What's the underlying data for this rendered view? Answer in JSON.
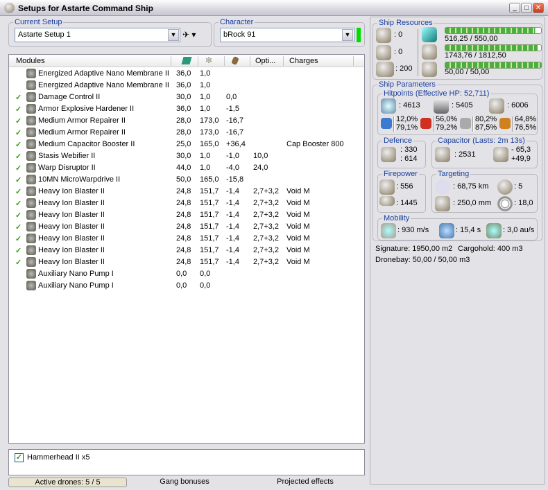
{
  "window": {
    "title": "Setups for Astarte Command Ship",
    "min": "_",
    "max": "□",
    "close": "✕"
  },
  "current_setup": {
    "label": "Current Setup",
    "value": "Astarte Setup 1"
  },
  "character": {
    "label": "Character",
    "value": "bRock 91",
    "status_color": "#00dd00"
  },
  "modules": {
    "headers": [
      "Modules",
      "Opti...",
      "Charges"
    ],
    "header_icons": [
      "cpu-icon",
      "powergrid-icon",
      "capacitor-icon"
    ],
    "rows": [
      {
        "checked": false,
        "name": "Energized Adaptive Nano Membrane II",
        "cpu": "36,0",
        "pg": "1,0",
        "cap": "",
        "opti": "",
        "charges": ""
      },
      {
        "checked": false,
        "name": "Energized Adaptive Nano Membrane II",
        "cpu": "36,0",
        "pg": "1,0",
        "cap": "",
        "opti": "",
        "charges": ""
      },
      {
        "checked": true,
        "name": "Damage Control II",
        "cpu": "30,0",
        "pg": "1,0",
        "cap": "0,0",
        "opti": "",
        "charges": ""
      },
      {
        "checked": true,
        "name": "Armor Explosive Hardener II",
        "cpu": "36,0",
        "pg": "1,0",
        "cap": "-1,5",
        "opti": "",
        "charges": ""
      },
      {
        "checked": true,
        "name": "Medium Armor Repairer II",
        "cpu": "28,0",
        "pg": "173,0",
        "cap": "-16,7",
        "opti": "",
        "charges": ""
      },
      {
        "checked": true,
        "name": "Medium Armor Repairer II",
        "cpu": "28,0",
        "pg": "173,0",
        "cap": "-16,7",
        "opti": "",
        "charges": ""
      },
      {
        "checked": true,
        "name": "Medium Capacitor Booster II",
        "cpu": "25,0",
        "pg": "165,0",
        "cap": "+36,4",
        "opti": "",
        "charges": "Cap Booster 800"
      },
      {
        "checked": true,
        "name": "Stasis Webifier II",
        "cpu": "30,0",
        "pg": "1,0",
        "cap": "-1,0",
        "opti": "10,0",
        "charges": ""
      },
      {
        "checked": true,
        "name": "Warp Disruptor II",
        "cpu": "44,0",
        "pg": "1,0",
        "cap": "-4,0",
        "opti": "24,0",
        "charges": ""
      },
      {
        "checked": true,
        "name": "10MN MicroWarpdrive II",
        "cpu": "50,0",
        "pg": "165,0",
        "cap": "-15,8",
        "opti": "",
        "charges": ""
      },
      {
        "checked": true,
        "name": "Heavy Ion Blaster II",
        "cpu": "24,8",
        "pg": "151,7",
        "cap": "-1,4",
        "opti": "2,7+3,2",
        "charges": "Void M"
      },
      {
        "checked": true,
        "name": "Heavy Ion Blaster II",
        "cpu": "24,8",
        "pg": "151,7",
        "cap": "-1,4",
        "opti": "2,7+3,2",
        "charges": "Void M"
      },
      {
        "checked": true,
        "name": "Heavy Ion Blaster II",
        "cpu": "24,8",
        "pg": "151,7",
        "cap": "-1,4",
        "opti": "2,7+3,2",
        "charges": "Void M"
      },
      {
        "checked": true,
        "name": "Heavy Ion Blaster II",
        "cpu": "24,8",
        "pg": "151,7",
        "cap": "-1,4",
        "opti": "2,7+3,2",
        "charges": "Void M"
      },
      {
        "checked": true,
        "name": "Heavy Ion Blaster II",
        "cpu": "24,8",
        "pg": "151,7",
        "cap": "-1,4",
        "opti": "2,7+3,2",
        "charges": "Void M"
      },
      {
        "checked": true,
        "name": "Heavy Ion Blaster II",
        "cpu": "24,8",
        "pg": "151,7",
        "cap": "-1,4",
        "opti": "2,7+3,2",
        "charges": "Void M"
      },
      {
        "checked": true,
        "name": "Heavy Ion Blaster II",
        "cpu": "24,8",
        "pg": "151,7",
        "cap": "-1,4",
        "opti": "2,7+3,2",
        "charges": "Void M"
      },
      {
        "checked": false,
        "name": "Auxiliary Nano Pump I",
        "cpu": "0,0",
        "pg": "0,0",
        "cap": "",
        "opti": "",
        "charges": ""
      },
      {
        "checked": false,
        "name": "Auxiliary Nano Pump I",
        "cpu": "0,0",
        "pg": "0,0",
        "cap": "",
        "opti": "",
        "charges": ""
      }
    ]
  },
  "drones": {
    "items": [
      {
        "checked": true,
        "name": "Hammerhead II x5"
      }
    ]
  },
  "tabs": [
    "Active drones: 5 / 5",
    "Gang bonuses",
    "Projected effects"
  ],
  "resources": {
    "label": "Ship Resources",
    "turrets": ": 0",
    "launchers": ": 0",
    "calibration": ": 200",
    "cpu": "516,25 / 550,00",
    "cpu_fraction": 0.939,
    "powergrid": "1743,76 / 1812,50",
    "powergrid_fraction": 0.962,
    "drone_bandwidth": "50,00 / 50,00",
    "drone_fraction": 1.0
  },
  "params": {
    "label": "Ship Parameters",
    "hitpoints": {
      "label": "Hitpoints (Effective HP: 52,711)",
      "shield": ": 4613",
      "armor": ": 5405",
      "structure": ": 6006",
      "resists": [
        {
          "a": "12,0%",
          "b": "79,1%"
        },
        {
          "a": "56,0%",
          "b": "79,2%"
        },
        {
          "a": "80,2%",
          "b": "87,5%"
        },
        {
          "a": "64,8%",
          "b": "76,5%"
        }
      ]
    },
    "defence": {
      "label": "Defence",
      "a": ": 330",
      "b": ": 614"
    },
    "capacitor": {
      "label": "Capacitor (Lasts: 2m 13s)",
      "amount": ": 2531",
      "use": "- 65,3",
      "recharge": "+49,9"
    },
    "firepower": {
      "label": "Firepower",
      "a": ": 556",
      "b": ": 1445"
    },
    "targeting": {
      "label": "Targeting",
      "range": ": 68,75 km",
      "targets": ": 5",
      "resolution": ": 250,0 mm",
      "sensor": ": 18,0"
    },
    "mobility": {
      "label": "Mobility",
      "speed": ": 930 m/s",
      "align": ": 15,4 s",
      "warp": ": 3,0 au/s"
    },
    "signature": "Signature: 1950,00 m2",
    "cargohold": "Cargohold: 400 m3",
    "dronebay": "Dronebay: 50,00 / 50,00 m3"
  }
}
